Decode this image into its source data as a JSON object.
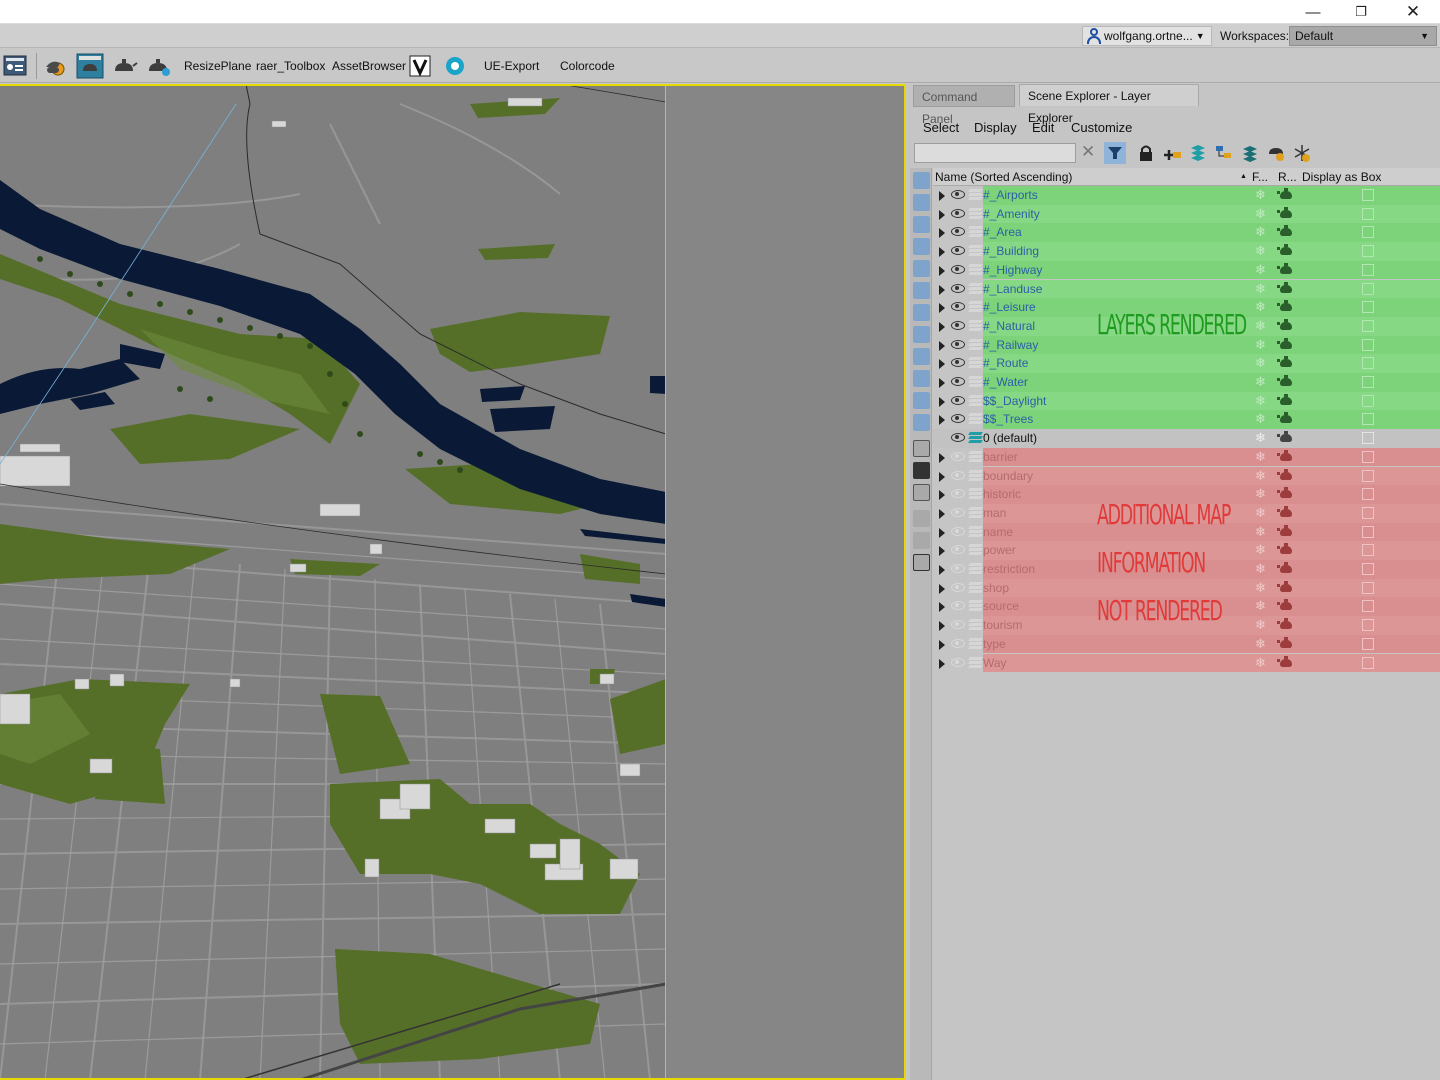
{
  "window": {
    "min_glyph": "—",
    "max_glyph": "❐",
    "close_glyph": "✕"
  },
  "userbar": {
    "user_name": "wolfgang.ortne...",
    "workspaces_label": "Workspaces:",
    "workspace_value": "Default"
  },
  "toolbar": {
    "items": [
      "ResizePlane",
      "raer_Toolbox",
      "AssetBrowser",
      "UE-Export",
      "Colorcode"
    ],
    "icons": [
      "render-setup-icon",
      "render-frame-icon",
      "teapot-render-icon",
      "teapot-render-active-icon",
      "teapot-iterative-icon",
      "vray-icon",
      "autodesk-icon"
    ]
  },
  "panel": {
    "tabs": [
      "Command Panel",
      "Scene Explorer - Layer Explorer"
    ],
    "menu": [
      "Select",
      "Display",
      "Edit",
      "Customize"
    ],
    "search_value": "",
    "columns": {
      "name": "Name (Sorted Ascending)",
      "sort_glyph": "▲",
      "frozen": "F...",
      "renderable": "R...",
      "display_as_box": "Display as Box"
    },
    "layers_rendered": [
      "#_Airports",
      "#_Amenity",
      "#_Area",
      "#_Building",
      "#_Highway",
      "#_Landuse",
      "#_Leisure",
      "#_Natural",
      "#_Railway",
      "#_Route",
      "#_Water",
      "$$_Daylight",
      "$$_Trees"
    ],
    "default_layer": "0 (default)",
    "layers_not_rendered": [
      "barrier",
      "boundary",
      "historic",
      "man",
      "name",
      "power",
      "restriction",
      "shop",
      "source",
      "tourism",
      "type",
      "Way"
    ]
  },
  "annotations": {
    "green": "LAYERS RENDERED",
    "red_1": "ADDITIONAL MAP",
    "red_2": "INFORMATION",
    "red_3": "NOT RENDERED"
  },
  "colors": {
    "rendered_row": "#7cd37a",
    "not_rendered_row": "#d98f8f",
    "viewport_frame": "#e6d800",
    "water": "#0a1a36",
    "vegetation": "#566f28"
  }
}
